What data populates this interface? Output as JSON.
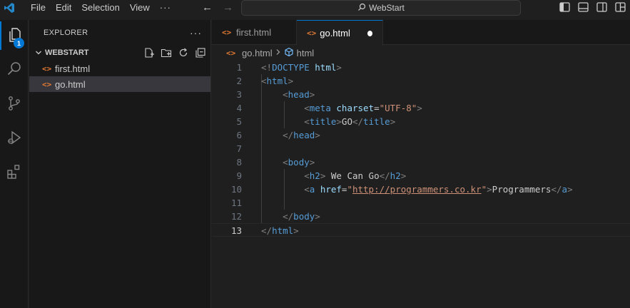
{
  "titlebar": {
    "menu": [
      "File",
      "Edit",
      "Selection",
      "View",
      "···"
    ],
    "search_text": "WebStart"
  },
  "activity": {
    "explorer_badge": "1"
  },
  "sidebar": {
    "title": "EXPLORER",
    "more": "···",
    "folder_name": "WEBSTART",
    "files": [
      {
        "name": "first.html",
        "selected": false
      },
      {
        "name": "go.html",
        "selected": true
      }
    ]
  },
  "tabs": [
    {
      "label": "first.html",
      "active": false,
      "dirty": false
    },
    {
      "label": "go.html",
      "active": true,
      "dirty": true
    }
  ],
  "breadcrumb": {
    "file": "go.html",
    "symbol": "html"
  },
  "editor": {
    "current_line": 13,
    "lines": [
      {
        "n": "1",
        "code": "<!DOCTYPE html>"
      },
      {
        "n": "2",
        "code": "<html>"
      },
      {
        "n": "3",
        "code": "    <head>"
      },
      {
        "n": "4",
        "code": "        <meta charset=\"UTF-8\">"
      },
      {
        "n": "5",
        "code": "        <title>GO</title>"
      },
      {
        "n": "6",
        "code": "    </head>"
      },
      {
        "n": "7",
        "code": ""
      },
      {
        "n": "8",
        "code": "    <body>"
      },
      {
        "n": "9",
        "code": "        <h2> We Can Go</h2>"
      },
      {
        "n": "10",
        "code": "        <a href=\"http://programmers.co.kr\">Programmers</a>"
      },
      {
        "n": "11",
        "code": ""
      },
      {
        "n": "12",
        "code": "    </body>"
      },
      {
        "n": "13",
        "code": "</html>"
      }
    ]
  },
  "colors": {
    "accent": "#0078d4",
    "file_icon": "#e37933"
  }
}
